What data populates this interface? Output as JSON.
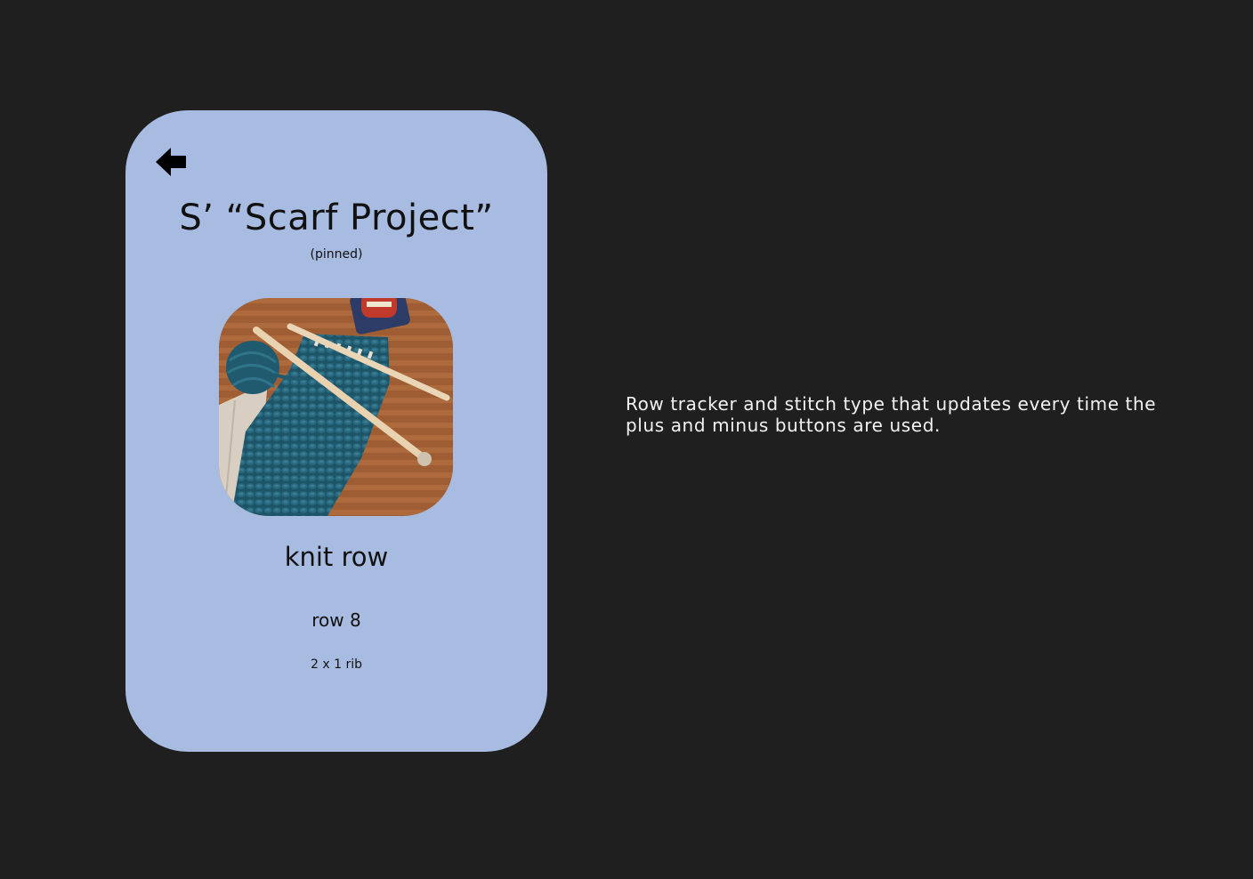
{
  "card": {
    "back_icon": "arrow-left-icon",
    "title": "S’ “Scarf Project”",
    "subtitle": "(pinned)",
    "photo": {
      "subject": "knitting-project-photo",
      "colors": {
        "table": "#a7643a",
        "yarn": "#1f5a6e",
        "needle": "#e9d2b0"
      }
    },
    "stitch_type": "knit row",
    "row_label": "row 8",
    "pattern": "2 x 1 rib"
  },
  "annotation": {
    "text": "Row tracker and stitch type that updates every time the plus and minus buttons are used."
  },
  "colors": {
    "background": "#1f1f1f",
    "card": "#a8bbe0",
    "text_dark": "#111111",
    "text_light": "#f2f2f2"
  }
}
